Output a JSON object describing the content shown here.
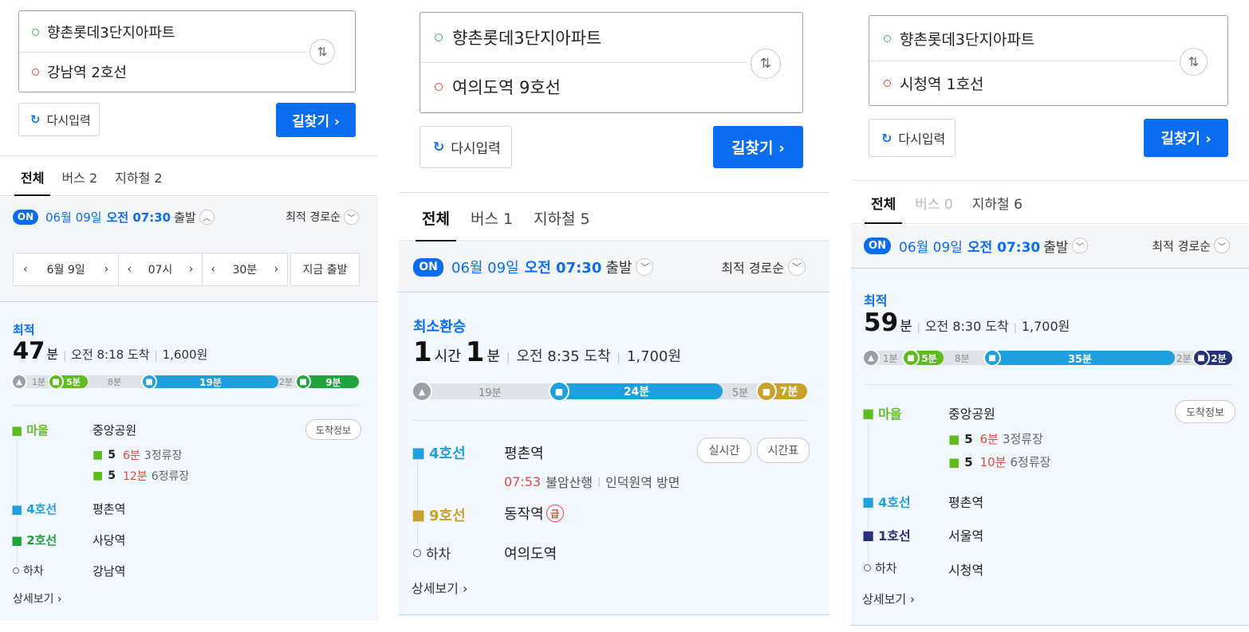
{
  "colors": {
    "primary": "#0a6df0",
    "village_bus": "#5fbc1e",
    "line4": "#1e9fde",
    "line2": "#1fa33c",
    "line9": "#c9a12a",
    "line1": "#25317a",
    "red_time": "#e8463c"
  },
  "panels": [
    {
      "search": {
        "origin": "향촌롯데3단지아파트",
        "destination": "강남역 2호선",
        "swap_icon": "swap-arrows-icon"
      },
      "reset_label": "다시입력",
      "find_label": "길찾기 ›",
      "tabs": [
        {
          "label": "전체"
        },
        {
          "label": "버스 2"
        },
        {
          "label": "지하철 2"
        }
      ],
      "departure": {
        "badge": "ON",
        "date": "06월 09일",
        "time": "오전 07:30",
        "suffix": "출발",
        "sort": "최적 경로순"
      },
      "time_picker": {
        "date": "6월 9일",
        "hour": "07시",
        "minute": "30분",
        "now": "지금 출발"
      },
      "result": {
        "label": "최적",
        "duration_num1": "47",
        "duration_unit1": "분",
        "arrival": "오전 8:18 도착",
        "fare": "1,600원",
        "bar": [
          {
            "kind": "walk",
            "label": "1분"
          },
          {
            "kind": "bus",
            "label": "5분",
            "share": 0.1
          },
          {
            "kind": "wait",
            "label": "8분"
          },
          {
            "kind": "line4",
            "label": "19분",
            "share": 0.41
          },
          {
            "kind": "wait",
            "label": "2분"
          },
          {
            "kind": "line2",
            "label": "9분",
            "share": 0.2
          }
        ],
        "steps": [
          {
            "mode": "마을",
            "name": "중앙공원",
            "button": "도착정보",
            "subs": [
              {
                "num": "5",
                "min": "6분",
                "stops": "3정류장"
              },
              {
                "num": "5",
                "min": "12분",
                "stops": "6정류장"
              }
            ]
          },
          {
            "mode": "4호선",
            "name": "평촌역"
          },
          {
            "mode": "2호선",
            "name": "사당역"
          },
          {
            "mode": "하차",
            "name": "강남역"
          }
        ],
        "more": "상세보기 ›"
      }
    },
    {
      "search": {
        "origin": "향촌롯데3단지아파트",
        "destination": "여의도역 9호선",
        "swap_icon": "swap-arrows-icon"
      },
      "reset_label": "다시입력",
      "find_label": "길찾기 ›",
      "tabs": [
        {
          "label": "전체"
        },
        {
          "label": "버스 1"
        },
        {
          "label": "지하철 5"
        }
      ],
      "departure": {
        "badge": "ON",
        "date": "06월 09일",
        "time": "오전 07:30",
        "suffix": "출발",
        "sort": "최적 경로순"
      },
      "result": {
        "label": "최소환승",
        "duration_num1": "1",
        "duration_unit1": "시간",
        "duration_num2": "1",
        "duration_unit2": "분",
        "arrival": "오전 8:35 도착",
        "fare": "1,700원",
        "bar": [
          {
            "kind": "walk",
            "label": "19분"
          },
          {
            "kind": "line4",
            "label": "24분",
            "share": 0.4
          },
          {
            "kind": "wait",
            "label": "5분"
          },
          {
            "kind": "line9",
            "label": "7분",
            "share": 0.12
          }
        ],
        "steps": [
          {
            "mode": "4호선",
            "name": "평촌역",
            "buttons": [
              "실시간",
              "시간표"
            ],
            "detail_time": "07:53",
            "detail_dir": "불암산행",
            "detail_way": "인덕원역 방면"
          },
          {
            "mode": "9호선",
            "name": "동작역",
            "express": "급"
          },
          {
            "mode": "하차",
            "name": "여의도역"
          }
        ],
        "more": "상세보기 ›"
      }
    },
    {
      "search": {
        "origin": "향촌롯데3단지아파트",
        "destination": "시청역 1호선",
        "swap_icon": "swap-arrows-icon"
      },
      "reset_label": "다시입력",
      "find_label": "길찾기 ›",
      "tabs": [
        {
          "label": "전체"
        },
        {
          "label": "버스 0"
        },
        {
          "label": "지하철 6"
        }
      ],
      "departure": {
        "badge": "ON",
        "date": "06월 09일",
        "time": "오전 07:30",
        "suffix": "출발",
        "sort": "최적 경로순"
      },
      "result": {
        "label": "최적",
        "duration_num1": "59",
        "duration_unit1": "분",
        "arrival": "오전 8:30 도착",
        "fare": "1,700원",
        "bar": [
          {
            "kind": "walk",
            "label": "1분"
          },
          {
            "kind": "bus",
            "label": "5분",
            "share": 0.1
          },
          {
            "kind": "wait",
            "label": "8분"
          },
          {
            "kind": "line4",
            "label": "35분",
            "share": 0.52
          },
          {
            "kind": "wait",
            "label": "2분"
          },
          {
            "kind": "line1",
            "label": "2분",
            "share": 0.08
          }
        ],
        "steps": [
          {
            "mode": "마을",
            "name": "중앙공원",
            "button": "도착정보",
            "subs": [
              {
                "num": "5",
                "min": "6분",
                "stops": "3정류장"
              },
              {
                "num": "5",
                "min": "10분",
                "stops": "6정류장"
              }
            ]
          },
          {
            "mode": "4호선",
            "name": "평촌역"
          },
          {
            "mode": "1호선",
            "name": "서울역"
          },
          {
            "mode": "하차",
            "name": "시청역"
          }
        ],
        "more": "상세보기 ›"
      }
    }
  ]
}
